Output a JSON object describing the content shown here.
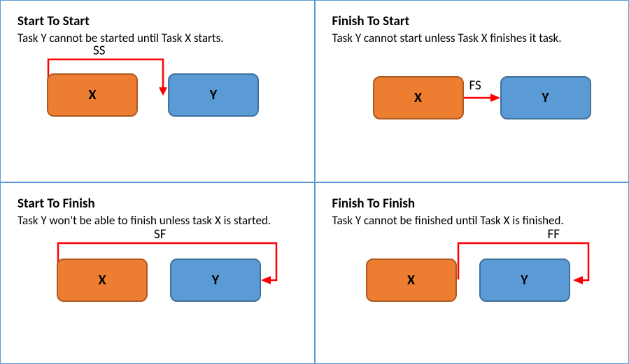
{
  "panels": {
    "ss": {
      "title": "Start To Start",
      "desc": "Task Y cannot be started until Task X starts.",
      "label": "SS",
      "taskX": "X",
      "taskY": "Y"
    },
    "fs": {
      "title": "Finish To Start",
      "desc": "Task Y cannot start unless Task X finishes it task.",
      "label": "FS",
      "taskX": "X",
      "taskY": "Y"
    },
    "sf": {
      "title": "Start To Finish",
      "desc": "Task Y won't be able to finish unless task X is started.",
      "label": "SF",
      "taskX": "X",
      "taskY": "Y"
    },
    "ff": {
      "title": "Finish To Finish",
      "desc": "Task Y cannot be finished until Task X is finished.",
      "label": "FF",
      "taskX": "X",
      "taskY": "Y"
    }
  },
  "colors": {
    "border": "#5B9BD5",
    "taskX": "#ED7D31",
    "taskY": "#5B9BD5",
    "arrow": "#FF0000"
  },
  "chart_data": [
    {
      "type": "diagram",
      "id": "start-to-start",
      "title": "Start To Start",
      "code": "SS",
      "rule": "Task Y cannot be started until Task X starts.",
      "nodes": [
        {
          "id": "X",
          "role": "predecessor"
        },
        {
          "id": "Y",
          "role": "successor"
        }
      ],
      "edge": {
        "from": "X",
        "from_side": "start",
        "to": "Y",
        "to_side": "start"
      }
    },
    {
      "type": "diagram",
      "id": "finish-to-start",
      "title": "Finish To Start",
      "code": "FS",
      "rule": "Task Y cannot start unless Task X finishes it task.",
      "nodes": [
        {
          "id": "X",
          "role": "predecessor"
        },
        {
          "id": "Y",
          "role": "successor"
        }
      ],
      "edge": {
        "from": "X",
        "from_side": "finish",
        "to": "Y",
        "to_side": "start"
      }
    },
    {
      "type": "diagram",
      "id": "start-to-finish",
      "title": "Start To Finish",
      "code": "SF",
      "rule": "Task Y won't be able to finish unless task X is started.",
      "nodes": [
        {
          "id": "X",
          "role": "predecessor"
        },
        {
          "id": "Y",
          "role": "successor"
        }
      ],
      "edge": {
        "from": "X",
        "from_side": "start",
        "to": "Y",
        "to_side": "finish"
      }
    },
    {
      "type": "diagram",
      "id": "finish-to-finish",
      "title": "Finish To Finish",
      "code": "FF",
      "rule": "Task Y cannot be finished until Task X is finished.",
      "nodes": [
        {
          "id": "X",
          "role": "predecessor"
        },
        {
          "id": "Y",
          "role": "successor"
        }
      ],
      "edge": {
        "from": "X",
        "from_side": "finish",
        "to": "Y",
        "to_side": "finish"
      }
    }
  ]
}
